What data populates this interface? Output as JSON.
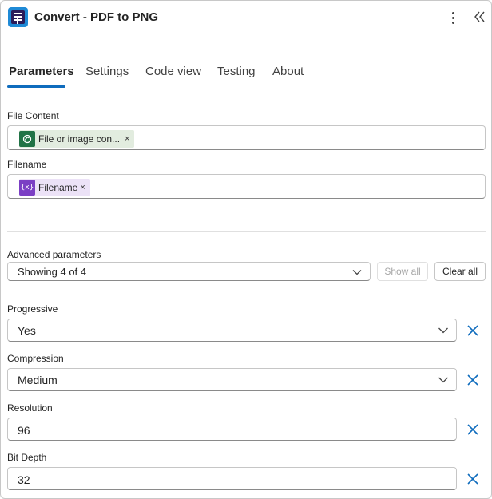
{
  "header": {
    "title": "Convert - PDF to PNG",
    "icons": {
      "app": "app-logo-icon",
      "more": "more-vertical-icon",
      "collapse": "double-chevron-left-icon"
    }
  },
  "tabs": [
    {
      "label": "Parameters",
      "active": true
    },
    {
      "label": "Settings",
      "active": false
    },
    {
      "label": "Code view",
      "active": false
    },
    {
      "label": "Testing",
      "active": false
    },
    {
      "label": "About",
      "active": false
    }
  ],
  "file_content": {
    "label": "File Content",
    "token": {
      "text": "File or image con...",
      "close": "×",
      "icon": "sharepoint-icon",
      "color": "#217346"
    }
  },
  "filename": {
    "label": "Filename",
    "token": {
      "text": "Filename",
      "close": "×",
      "icon_text": "{x}",
      "icon": "variable-icon",
      "color": "#7b3fc4"
    }
  },
  "advanced": {
    "label": "Advanced parameters",
    "selected": "Showing 4 of 4",
    "show_all": "Show all",
    "clear_all": "Clear all"
  },
  "params": {
    "progressive": {
      "label": "Progressive",
      "value": "Yes"
    },
    "compression": {
      "label": "Compression",
      "value": "Medium"
    },
    "resolution": {
      "label": "Resolution",
      "value": "96"
    },
    "bit_depth": {
      "label": "Bit Depth",
      "value": "32"
    }
  },
  "colors": {
    "accent": "#0f6cbd",
    "remove_icon": "#0f6cbd"
  }
}
